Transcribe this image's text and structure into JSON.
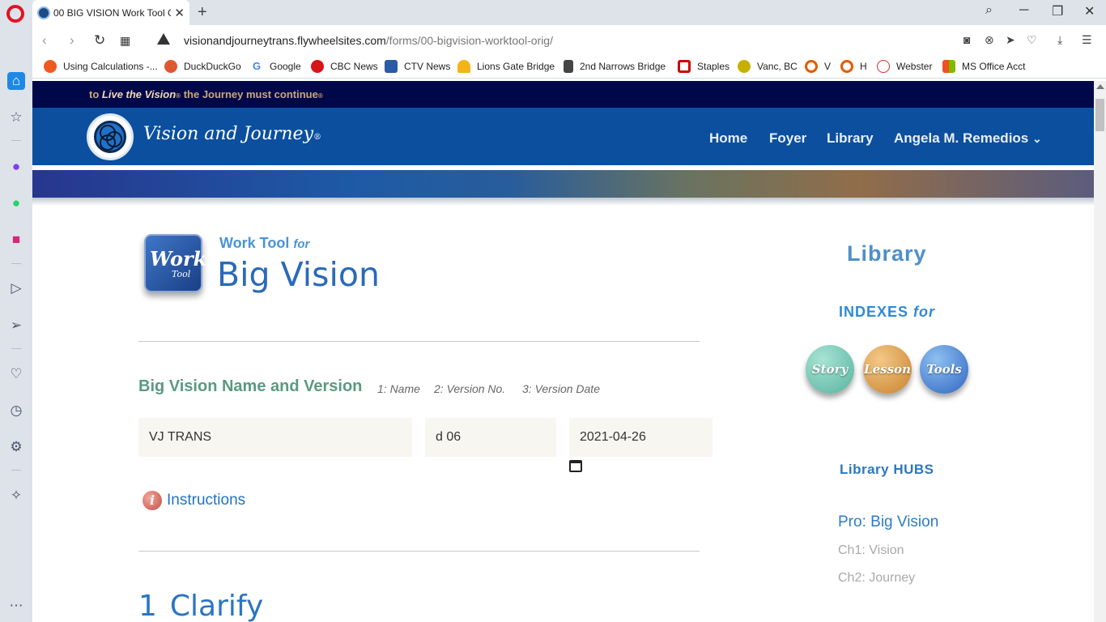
{
  "browser": {
    "tab_title": "00 BIG VISION Work Tool C",
    "url_host": "visionandjourneytrans.flywheelsites.com",
    "url_path": "/forms/00-bigvision-worktool-orig/",
    "bookmarks": [
      {
        "label": "Using Calculations -...",
        "icon": "calc-icon",
        "color": "#ef5a22"
      },
      {
        "label": "DuckDuckGo",
        "icon": "duckduckgo-icon",
        "color": "#de5833"
      },
      {
        "label": "Google",
        "icon": "google-icon",
        "color": "#4285f4"
      },
      {
        "label": "CBC News",
        "icon": "cbc-icon",
        "color": "#d7141a"
      },
      {
        "label": "CTV News",
        "icon": "ctv-icon",
        "color": "#2b5aa6"
      },
      {
        "label": "Lions Gate Bridge",
        "icon": "bridge-icon",
        "color": "#f3b31b"
      },
      {
        "label": "2nd Narrows Bridge",
        "icon": "document-icon",
        "color": "#333333"
      },
      {
        "label": "Staples",
        "icon": "staples-icon",
        "color": "#cc0000"
      },
      {
        "label": "Vanc, BC",
        "icon": "vanc-icon",
        "color": "#c8b000"
      },
      {
        "label": "V",
        "icon": "v-icon",
        "color": "#e25a00"
      },
      {
        "label": "H",
        "icon": "h-icon",
        "color": "#e25a00"
      },
      {
        "label": "Webster",
        "icon": "webster-icon",
        "color": "#d32f2f"
      },
      {
        "label": "MS Office Acct",
        "icon": "ms-office-icon",
        "color": "#f25022"
      }
    ]
  },
  "site": {
    "tagline_pre": "to",
    "tagline_italic": "Live the Vision",
    "tagline_post": "the Journey must continue",
    "reg_mark": "®",
    "brand": "Vision and Journey",
    "nav": [
      "Home",
      "Foyer",
      "Library",
      "Angela M. Remedios"
    ],
    "nav_caret": "⌄"
  },
  "page": {
    "icon_word": "Work",
    "icon_sub": "Tool",
    "work_tool": "Work Tool",
    "for": "for",
    "title": "Big Vision",
    "section_label": "Big Vision Name and Version",
    "hints": [
      "1: Name",
      "2: Version No.",
      "3: Version Date"
    ],
    "fields": {
      "name": "VJ TRANS",
      "version": "d 06",
      "date": "2021-04-26"
    },
    "instructions": "Instructions",
    "section_num": "1",
    "section_title": "Clarify"
  },
  "sidebar": {
    "library": "Library",
    "indexes": "INDEXES",
    "for": "for",
    "buttons": [
      {
        "label": "Story",
        "color": "#6cc3b0"
      },
      {
        "label": "Lesson",
        "color": "#d7963e"
      },
      {
        "label": "Tools",
        "color": "#3c7fd2"
      }
    ],
    "hubs_title": "Library HUBS",
    "pro_label": "Pro:",
    "pro_value": "Big Vision",
    "chapters": [
      {
        "label": "Ch1:",
        "value": "Vision"
      },
      {
        "label": "Ch2:",
        "value": "Journey"
      }
    ]
  }
}
